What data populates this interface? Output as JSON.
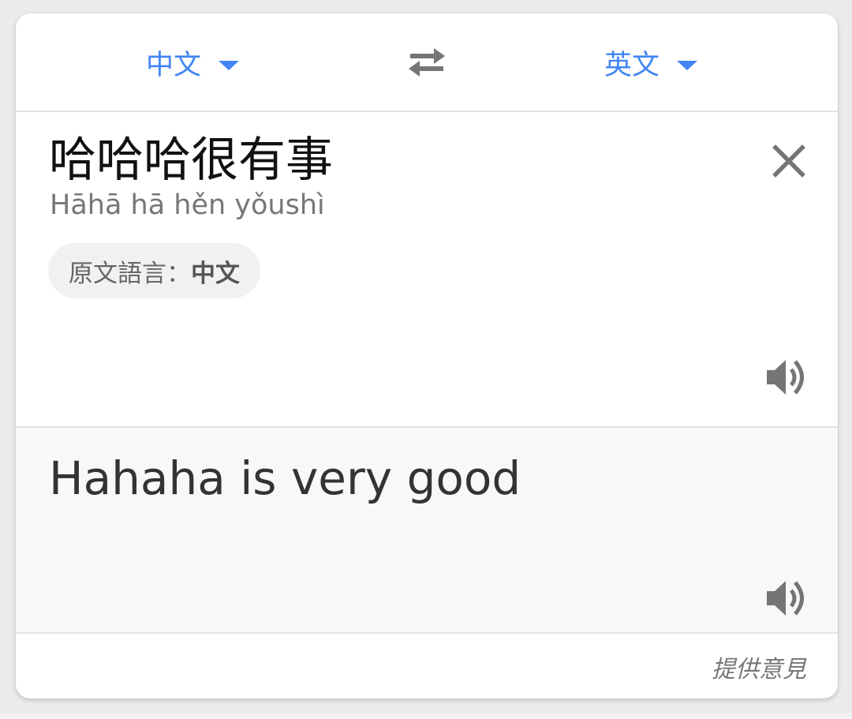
{
  "language_bar": {
    "source_language": "中文",
    "target_language": "英文"
  },
  "source": {
    "text": "哈哈哈很有事",
    "romanization": "Hāhā hā hěn yǒushì",
    "detected_prefix": "原文語言：",
    "detected_language": "中文"
  },
  "translation": {
    "text": "Hahaha is very good"
  },
  "footer": {
    "feedback_label": "提供意見"
  },
  "colors": {
    "accent": "#4285f4",
    "icon": "#757575",
    "translation_bg": "#f7f8fa"
  },
  "icons": {
    "swap": "swap-arrows-icon",
    "clear": "close-icon",
    "speaker": "volume-up-icon",
    "dropdown": "caret-down-icon"
  }
}
